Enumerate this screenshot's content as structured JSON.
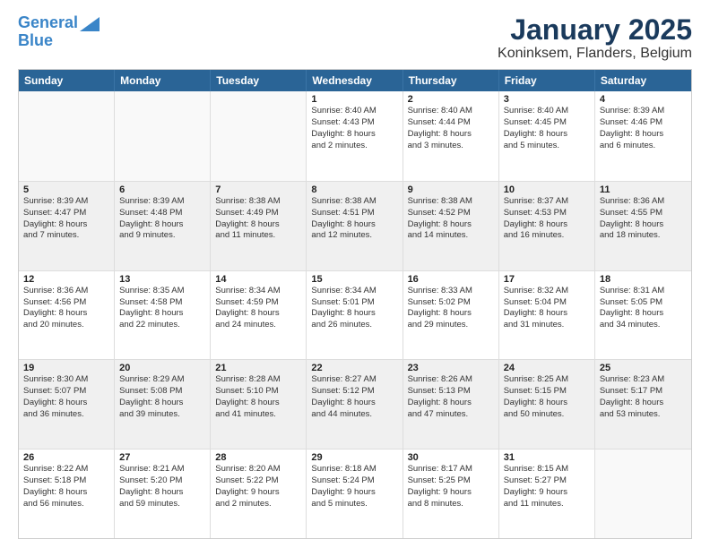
{
  "logo": {
    "line1": "General",
    "line2": "Blue"
  },
  "title": "January 2025",
  "subtitle": "Koninksem, Flanders, Belgium",
  "header": {
    "days": [
      "Sunday",
      "Monday",
      "Tuesday",
      "Wednesday",
      "Thursday",
      "Friday",
      "Saturday"
    ]
  },
  "weeks": [
    [
      {
        "day": "",
        "info": ""
      },
      {
        "day": "",
        "info": ""
      },
      {
        "day": "",
        "info": ""
      },
      {
        "day": "1",
        "info": "Sunrise: 8:40 AM\nSunset: 4:43 PM\nDaylight: 8 hours\nand 2 minutes."
      },
      {
        "day": "2",
        "info": "Sunrise: 8:40 AM\nSunset: 4:44 PM\nDaylight: 8 hours\nand 3 minutes."
      },
      {
        "day": "3",
        "info": "Sunrise: 8:40 AM\nSunset: 4:45 PM\nDaylight: 8 hours\nand 5 minutes."
      },
      {
        "day": "4",
        "info": "Sunrise: 8:39 AM\nSunset: 4:46 PM\nDaylight: 8 hours\nand 6 minutes."
      }
    ],
    [
      {
        "day": "5",
        "info": "Sunrise: 8:39 AM\nSunset: 4:47 PM\nDaylight: 8 hours\nand 7 minutes."
      },
      {
        "day": "6",
        "info": "Sunrise: 8:39 AM\nSunset: 4:48 PM\nDaylight: 8 hours\nand 9 minutes."
      },
      {
        "day": "7",
        "info": "Sunrise: 8:38 AM\nSunset: 4:49 PM\nDaylight: 8 hours\nand 11 minutes."
      },
      {
        "day": "8",
        "info": "Sunrise: 8:38 AM\nSunset: 4:51 PM\nDaylight: 8 hours\nand 12 minutes."
      },
      {
        "day": "9",
        "info": "Sunrise: 8:38 AM\nSunset: 4:52 PM\nDaylight: 8 hours\nand 14 minutes."
      },
      {
        "day": "10",
        "info": "Sunrise: 8:37 AM\nSunset: 4:53 PM\nDaylight: 8 hours\nand 16 minutes."
      },
      {
        "day": "11",
        "info": "Sunrise: 8:36 AM\nSunset: 4:55 PM\nDaylight: 8 hours\nand 18 minutes."
      }
    ],
    [
      {
        "day": "12",
        "info": "Sunrise: 8:36 AM\nSunset: 4:56 PM\nDaylight: 8 hours\nand 20 minutes."
      },
      {
        "day": "13",
        "info": "Sunrise: 8:35 AM\nSunset: 4:58 PM\nDaylight: 8 hours\nand 22 minutes."
      },
      {
        "day": "14",
        "info": "Sunrise: 8:34 AM\nSunset: 4:59 PM\nDaylight: 8 hours\nand 24 minutes."
      },
      {
        "day": "15",
        "info": "Sunrise: 8:34 AM\nSunset: 5:01 PM\nDaylight: 8 hours\nand 26 minutes."
      },
      {
        "day": "16",
        "info": "Sunrise: 8:33 AM\nSunset: 5:02 PM\nDaylight: 8 hours\nand 29 minutes."
      },
      {
        "day": "17",
        "info": "Sunrise: 8:32 AM\nSunset: 5:04 PM\nDaylight: 8 hours\nand 31 minutes."
      },
      {
        "day": "18",
        "info": "Sunrise: 8:31 AM\nSunset: 5:05 PM\nDaylight: 8 hours\nand 34 minutes."
      }
    ],
    [
      {
        "day": "19",
        "info": "Sunrise: 8:30 AM\nSunset: 5:07 PM\nDaylight: 8 hours\nand 36 minutes."
      },
      {
        "day": "20",
        "info": "Sunrise: 8:29 AM\nSunset: 5:08 PM\nDaylight: 8 hours\nand 39 minutes."
      },
      {
        "day": "21",
        "info": "Sunrise: 8:28 AM\nSunset: 5:10 PM\nDaylight: 8 hours\nand 41 minutes."
      },
      {
        "day": "22",
        "info": "Sunrise: 8:27 AM\nSunset: 5:12 PM\nDaylight: 8 hours\nand 44 minutes."
      },
      {
        "day": "23",
        "info": "Sunrise: 8:26 AM\nSunset: 5:13 PM\nDaylight: 8 hours\nand 47 minutes."
      },
      {
        "day": "24",
        "info": "Sunrise: 8:25 AM\nSunset: 5:15 PM\nDaylight: 8 hours\nand 50 minutes."
      },
      {
        "day": "25",
        "info": "Sunrise: 8:23 AM\nSunset: 5:17 PM\nDaylight: 8 hours\nand 53 minutes."
      }
    ],
    [
      {
        "day": "26",
        "info": "Sunrise: 8:22 AM\nSunset: 5:18 PM\nDaylight: 8 hours\nand 56 minutes."
      },
      {
        "day": "27",
        "info": "Sunrise: 8:21 AM\nSunset: 5:20 PM\nDaylight: 8 hours\nand 59 minutes."
      },
      {
        "day": "28",
        "info": "Sunrise: 8:20 AM\nSunset: 5:22 PM\nDaylight: 9 hours\nand 2 minutes."
      },
      {
        "day": "29",
        "info": "Sunrise: 8:18 AM\nSunset: 5:24 PM\nDaylight: 9 hours\nand 5 minutes."
      },
      {
        "day": "30",
        "info": "Sunrise: 8:17 AM\nSunset: 5:25 PM\nDaylight: 9 hours\nand 8 minutes."
      },
      {
        "day": "31",
        "info": "Sunrise: 8:15 AM\nSunset: 5:27 PM\nDaylight: 9 hours\nand 11 minutes."
      },
      {
        "day": "",
        "info": ""
      }
    ]
  ]
}
